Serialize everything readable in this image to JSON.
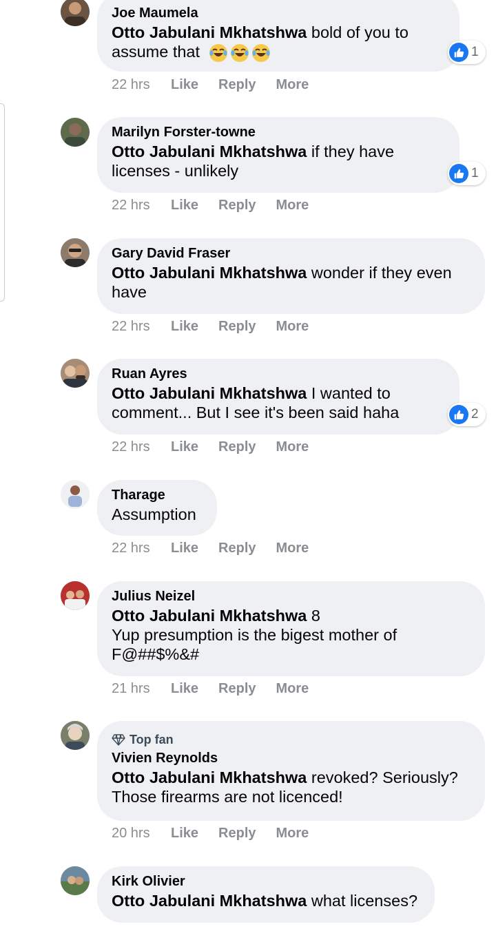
{
  "mention": "Otto Jabulani Mkhatshwa",
  "actions": {
    "like": "Like",
    "reply": "Reply",
    "more": "More"
  },
  "comments": [
    {
      "author": "Joe Maumela",
      "text": "bold of you to assume that",
      "time": "22 hrs",
      "reactions": "1",
      "emojis": [
        "laughing-emoji",
        "laughing-emoji",
        "laughing-emoji"
      ],
      "avatar_color": "#6b5442"
    },
    {
      "author": "Marilyn Forster-towne",
      "text": "if they have licenses - unlikely",
      "time": "22 hrs",
      "reactions": "1",
      "avatar_color": "#5e6b4a"
    },
    {
      "author": "Gary David Fraser",
      "text": "wonder if they even have",
      "time": "22 hrs",
      "avatar_color": "#8c7a6a"
    },
    {
      "author": "Ruan Ayres",
      "text": "I wanted to comment... But I see it's been said haha",
      "time": "22 hrs",
      "reactions": "2",
      "avatar_color": "#a88d76"
    },
    {
      "author": "Tharage",
      "text": "Assumption",
      "time": "22 hrs",
      "avatar_color": "#d8dce4"
    },
    {
      "author": "Julius Neizel",
      "text_line1": "8",
      "text_line2": "Yup presumption is the bigest mother of F@##$%&#",
      "time": "21 hrs",
      "avatar_color": "#b9312f"
    },
    {
      "badge": "Top fan",
      "author": "Vivien Reynolds",
      "text": "revoked? Seriously? Those firearms are not licenced!",
      "time": "20 hrs",
      "avatar_color": "#7a7f6a"
    },
    {
      "author": "Kirk Olivier",
      "text": "what licenses?",
      "time": "",
      "avatar_color": "#6b8aa0"
    }
  ]
}
